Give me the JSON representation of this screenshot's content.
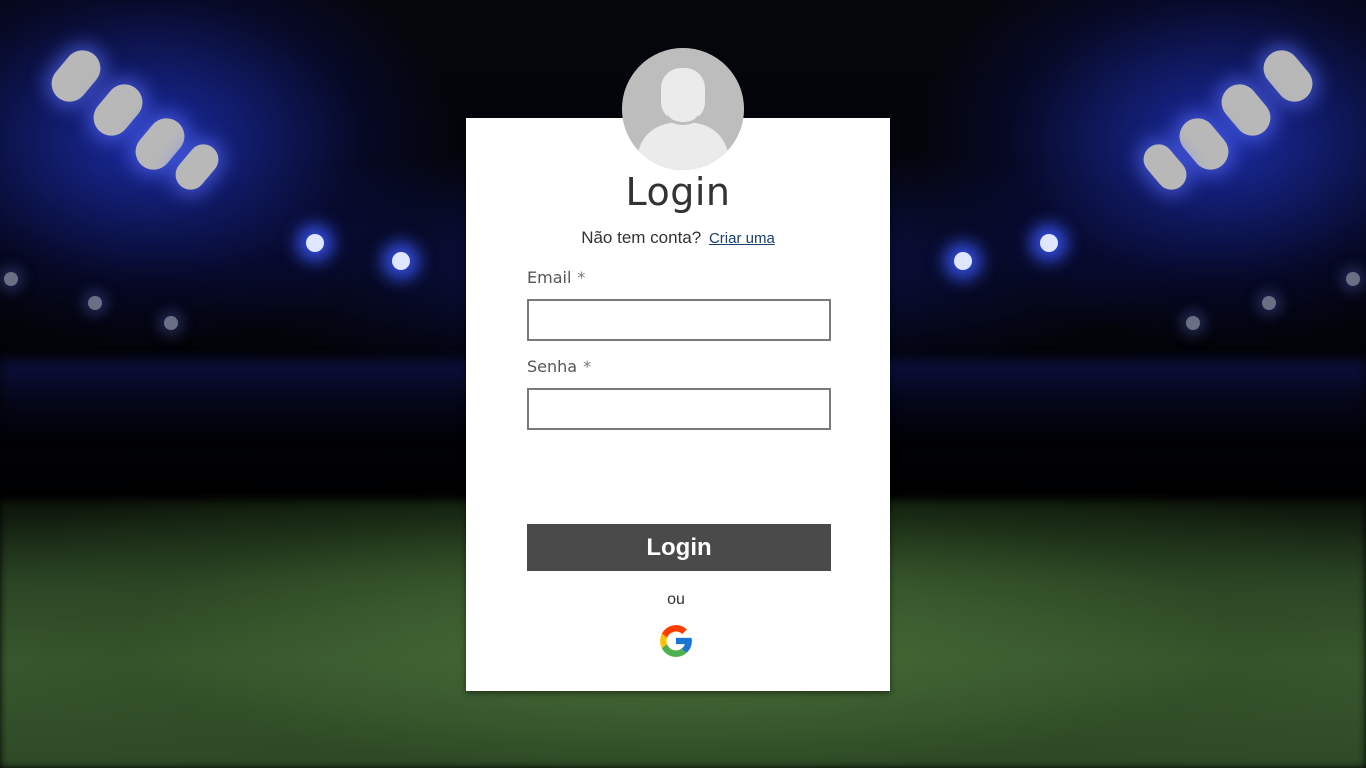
{
  "background": {
    "scene": "stadium-floodlights",
    "accent_color": "#2a3ad0",
    "field_color": "#3b5a30"
  },
  "login_card": {
    "avatar_icon": "user-avatar-icon",
    "title": "Login",
    "signup_prompt": "Não tem conta?",
    "signup_link": "Criar uma",
    "email": {
      "label": "Email",
      "required_marker": "*",
      "value": ""
    },
    "password": {
      "label": "Senha",
      "required_marker": "*",
      "value": ""
    },
    "submit_label": "Login",
    "separator": "ou",
    "google_icon": "google-icon",
    "button_color": "#4a4a4a"
  }
}
